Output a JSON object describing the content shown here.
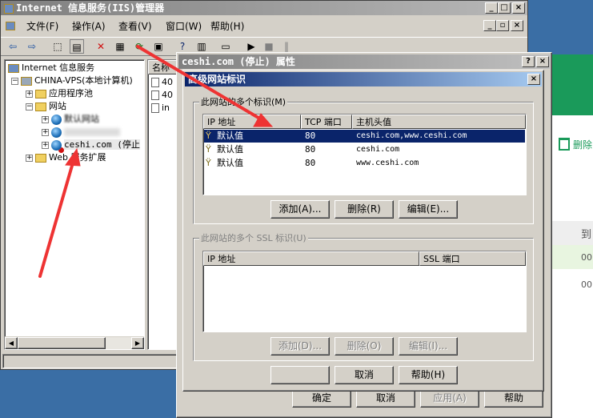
{
  "main_window": {
    "title": "Internet 信息服务(IIS)管理器",
    "menus": [
      "文件(F)",
      "操作(A)",
      "查看(V)",
      "窗口(W)",
      "帮助(H)"
    ],
    "tree": {
      "root": "Internet 信息服务",
      "computer": "CHINA-VPS(本地计算机)",
      "app_pools": "应用程序池",
      "websites": "网站",
      "default_site": "默认网站",
      "ceshi": "ceshi.com (停止",
      "web_ext": "Web 服务扩展"
    },
    "list_header": "名称",
    "list_items": [
      "40",
      "40",
      "in"
    ]
  },
  "props_dialog": {
    "title": "ceshi.com (停止) 属性",
    "help": "?",
    "close": "×",
    "ok": "确定",
    "cancel": "取消",
    "apply": "应用(A)",
    "help_button": "帮助"
  },
  "advanced_dialog": {
    "title": "高级网站标识",
    "close": "×",
    "identities_label": "此网站的多个标识(M)",
    "columns": [
      "IP 地址",
      "TCP 端口",
      "主机头值"
    ],
    "rows": [
      {
        "ip": "默认值",
        "port": "80",
        "host": "ceshi.com,www.ceshi.com"
      },
      {
        "ip": "默认值",
        "port": "80",
        "host": "ceshi.com"
      },
      {
        "ip": "默认值",
        "port": "80",
        "host": "www.ceshi.com"
      }
    ],
    "add": "添加(A)...",
    "remove": "删除(R)",
    "edit": "编辑(E)...",
    "ssl_label": "此网站的多个 SSL 标识(U)",
    "ssl_columns": [
      "IP 地址",
      "SSL 端口"
    ],
    "ssl_add": "添加(D)...",
    "ssl_remove": "删除(O)",
    "ssl_edit": "编辑(I)...",
    "ok": "",
    "cancel": "取消",
    "help": "帮助(H)"
  },
  "right_panel": {
    "delete": "删除",
    "col": "到",
    "row1": "00",
    "row2": "00"
  },
  "colors": {
    "desktop": "#3a6ea5",
    "titlebar": "#0a246a",
    "face": "#d4d0c8",
    "selection": "#0a246a",
    "arrow": "#ee3333",
    "green": "#1a9a5a"
  }
}
